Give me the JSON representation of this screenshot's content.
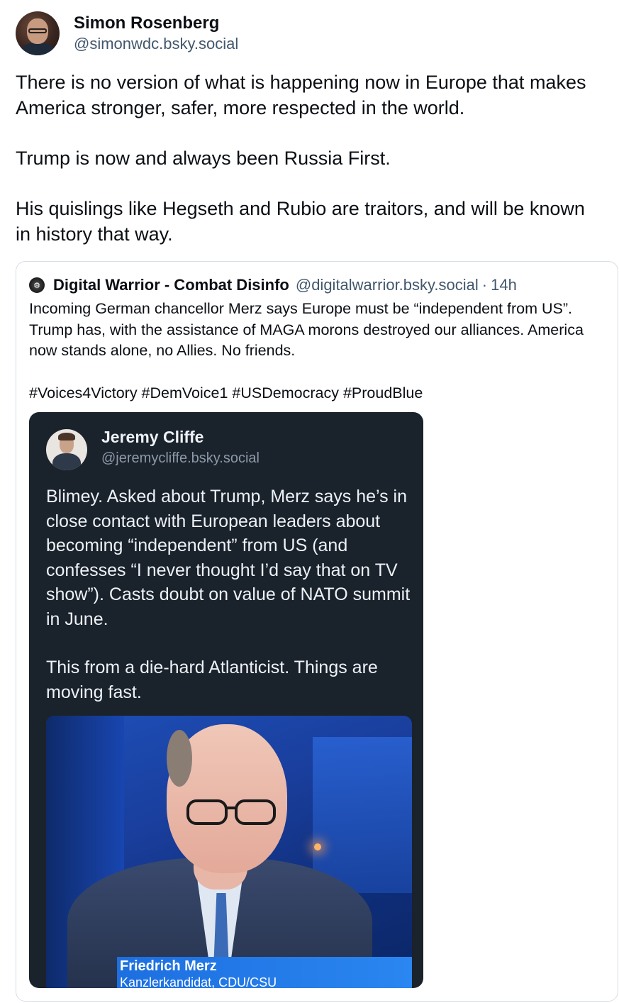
{
  "post": {
    "author": {
      "display_name": "Simon Rosenberg",
      "handle": "@simonwdc.bsky.social"
    },
    "paragraphs": [
      "There is no version of what is happening now in Europe that makes America stronger, safer, more respected in the world.",
      "Trump is now and always been Russia First.",
      "His quislings like Hegseth and Rubio are traitors, and will be known in history that way."
    ]
  },
  "quote": {
    "author": {
      "display_name": "Digital Warrior - Combat Disinfo",
      "handle": "@digitalwarrior.bsky.social",
      "separator": "·",
      "time": "14h"
    },
    "paragraphs": [
      "Incoming German chancellor Merz says Europe must be “independent from US”. Trump has, with the assistance of MAGA morons destroyed our alliances. America now stands alone, no Allies. No friends.",
      "#Voices4Victory #DemVoice1 #USDemocracy #ProudBlue"
    ],
    "embedded_screenshot": {
      "author": {
        "display_name": "Jeremy Cliffe",
        "handle": "@jeremycliffe.bsky.social"
      },
      "paragraphs": [
        "Blimey. Asked about Trump, Merz says he’s in close contact with European leaders about becoming “independent” from US (and confesses “I never thought I’d say that on TV show”). Casts doubt on value of NATO summit in June.",
        "This from a die-hard Atlanticist. Things are moving fast."
      ],
      "photo": {
        "lower_third_name": "Friedrich Merz",
        "lower_third_title": "Kanzlerkandidat, CDU/CSU"
      }
    }
  },
  "colors": {
    "text_primary": "#0b0f14",
    "text_secondary": "#42576c",
    "card_border": "#d6dee6",
    "embed_bg": "#1a222c"
  }
}
